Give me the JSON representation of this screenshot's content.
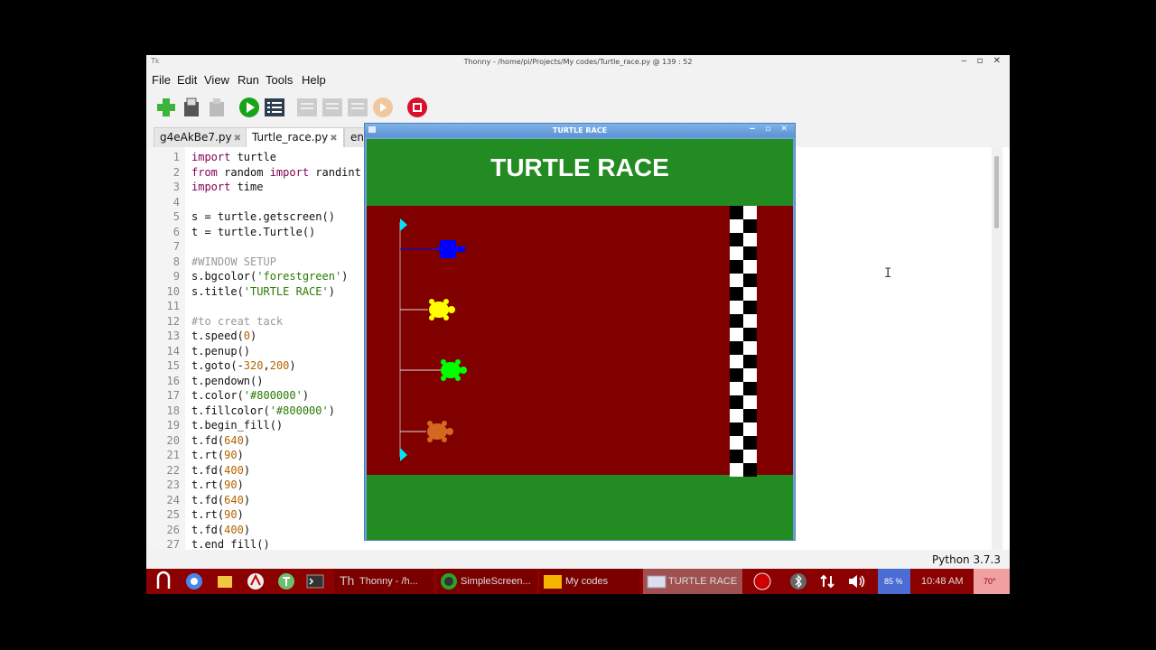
{
  "window": {
    "title": "Thonny  -  /home/pi/Projects/My codes/Turtle_race.py  @  139 : 52",
    "left_glyph": "Tk",
    "controls": "‒ ▫ ✕"
  },
  "menu": [
    "File",
    "Edit",
    "View",
    "Run",
    "Tools",
    "Help"
  ],
  "toolbar": {
    "buttons": [
      "new-file",
      "load-file",
      "save-file",
      "run",
      "debug",
      "step-over",
      "step-into",
      "step-out",
      "resume",
      "stop"
    ]
  },
  "tabs": [
    {
      "label": "g4eAkBe7.py",
      "close": "✖"
    },
    {
      "label": "Turtle_race.py",
      "close": "✖"
    },
    {
      "label": "en"
    }
  ],
  "editor": {
    "lines": [
      {
        "n": "1",
        "parts": [
          {
            "t": "kw",
            "v": "import"
          },
          {
            "t": "",
            "v": " turtle"
          }
        ]
      },
      {
        "n": "2",
        "parts": [
          {
            "t": "kw",
            "v": "from"
          },
          {
            "t": "",
            "v": " random "
          },
          {
            "t": "kw",
            "v": "import"
          },
          {
            "t": "",
            "v": " randint"
          }
        ]
      },
      {
        "n": "3",
        "parts": [
          {
            "t": "kw",
            "v": "import"
          },
          {
            "t": "",
            "v": " time"
          }
        ]
      },
      {
        "n": "4",
        "parts": []
      },
      {
        "n": "5",
        "parts": [
          {
            "t": "",
            "v": "s = turtle.getscreen()"
          }
        ]
      },
      {
        "n": "6",
        "parts": [
          {
            "t": "",
            "v": "t = turtle.Turtle()"
          }
        ]
      },
      {
        "n": "7",
        "parts": []
      },
      {
        "n": "8",
        "parts": [
          {
            "t": "cm",
            "v": "#WINDOW SETUP"
          }
        ]
      },
      {
        "n": "9",
        "parts": [
          {
            "t": "",
            "v": "s.bgcolor("
          },
          {
            "t": "str",
            "v": "'forestgreen'"
          },
          {
            "t": "",
            "v": ")"
          }
        ]
      },
      {
        "n": "10",
        "parts": [
          {
            "t": "",
            "v": "s.title("
          },
          {
            "t": "str",
            "v": "'TURTLE RACE'"
          },
          {
            "t": "",
            "v": ")"
          }
        ]
      },
      {
        "n": "11",
        "parts": []
      },
      {
        "n": "12",
        "parts": [
          {
            "t": "cm",
            "v": "#to creat tack"
          }
        ]
      },
      {
        "n": "13",
        "parts": [
          {
            "t": "",
            "v": "t.speed("
          },
          {
            "t": "num",
            "v": "0"
          },
          {
            "t": "",
            "v": ")"
          }
        ]
      },
      {
        "n": "14",
        "parts": [
          {
            "t": "",
            "v": "t.penup()"
          }
        ]
      },
      {
        "n": "15",
        "parts": [
          {
            "t": "",
            "v": "t.goto(-"
          },
          {
            "t": "num",
            "v": "320"
          },
          {
            "t": "",
            "v": ","
          },
          {
            "t": "num",
            "v": "200"
          },
          {
            "t": "",
            "v": ")"
          }
        ]
      },
      {
        "n": "16",
        "parts": [
          {
            "t": "",
            "v": "t.pendown()"
          }
        ]
      },
      {
        "n": "17",
        "parts": [
          {
            "t": "",
            "v": "t.color("
          },
          {
            "t": "str",
            "v": "'#800000'"
          },
          {
            "t": "",
            "v": ")"
          }
        ]
      },
      {
        "n": "18",
        "parts": [
          {
            "t": "",
            "v": "t.fillcolor("
          },
          {
            "t": "str",
            "v": "'#800000'"
          },
          {
            "t": "",
            "v": ")"
          }
        ]
      },
      {
        "n": "19",
        "parts": [
          {
            "t": "",
            "v": "t.begin_fill()"
          }
        ]
      },
      {
        "n": "20",
        "parts": [
          {
            "t": "",
            "v": "t.fd("
          },
          {
            "t": "num",
            "v": "640"
          },
          {
            "t": "",
            "v": ")"
          }
        ]
      },
      {
        "n": "21",
        "parts": [
          {
            "t": "",
            "v": "t.rt("
          },
          {
            "t": "num",
            "v": "90"
          },
          {
            "t": "",
            "v": ")"
          }
        ]
      },
      {
        "n": "22",
        "parts": [
          {
            "t": "",
            "v": "t.fd("
          },
          {
            "t": "num",
            "v": "400"
          },
          {
            "t": "",
            "v": ")"
          }
        ]
      },
      {
        "n": "23",
        "parts": [
          {
            "t": "",
            "v": "t.rt("
          },
          {
            "t": "num",
            "v": "90"
          },
          {
            "t": "",
            "v": ")"
          }
        ]
      },
      {
        "n": "24",
        "parts": [
          {
            "t": "",
            "v": "t.fd("
          },
          {
            "t": "num",
            "v": "640"
          },
          {
            "t": "",
            "v": ")"
          }
        ]
      },
      {
        "n": "25",
        "parts": [
          {
            "t": "",
            "v": "t.rt("
          },
          {
            "t": "num",
            "v": "90"
          },
          {
            "t": "",
            "v": ")"
          }
        ]
      },
      {
        "n": "26",
        "parts": [
          {
            "t": "",
            "v": "t.fd("
          },
          {
            "t": "num",
            "v": "400"
          },
          {
            "t": "",
            "v": ")"
          }
        ]
      },
      {
        "n": "27",
        "parts": [
          {
            "t": "",
            "v": "t.end_fill()"
          }
        ]
      }
    ]
  },
  "status": {
    "python_version": "Python 3.7.3"
  },
  "turtle_window": {
    "title": "TURTLE RACE",
    "heading": "TURTLE RACE",
    "controls": "‒ ▫ ✕",
    "colors": {
      "background": "#228b22",
      "track": "#800000",
      "turtles": [
        "#0000ff",
        "#ffff00",
        "#00ff00",
        "#d2691e"
      ],
      "flags": "#00e5ff"
    }
  },
  "taskbar": {
    "items": [
      {
        "icon": "raspberry-icon"
      },
      {
        "icon": "browser-icon"
      },
      {
        "icon": "folder-icon"
      },
      {
        "icon": "mathematica-icon"
      },
      {
        "icon": "thonny-icon"
      },
      {
        "icon": "terminal-icon"
      },
      {
        "label": "Thonny  -  /h..."
      },
      {
        "label": "SimpleScreen..."
      },
      {
        "label": "My codes"
      },
      {
        "label": "TURTLE RACE"
      }
    ],
    "tray": {
      "cpu": "85 %",
      "clock": "10:48 AM",
      "temp": "70°"
    }
  }
}
